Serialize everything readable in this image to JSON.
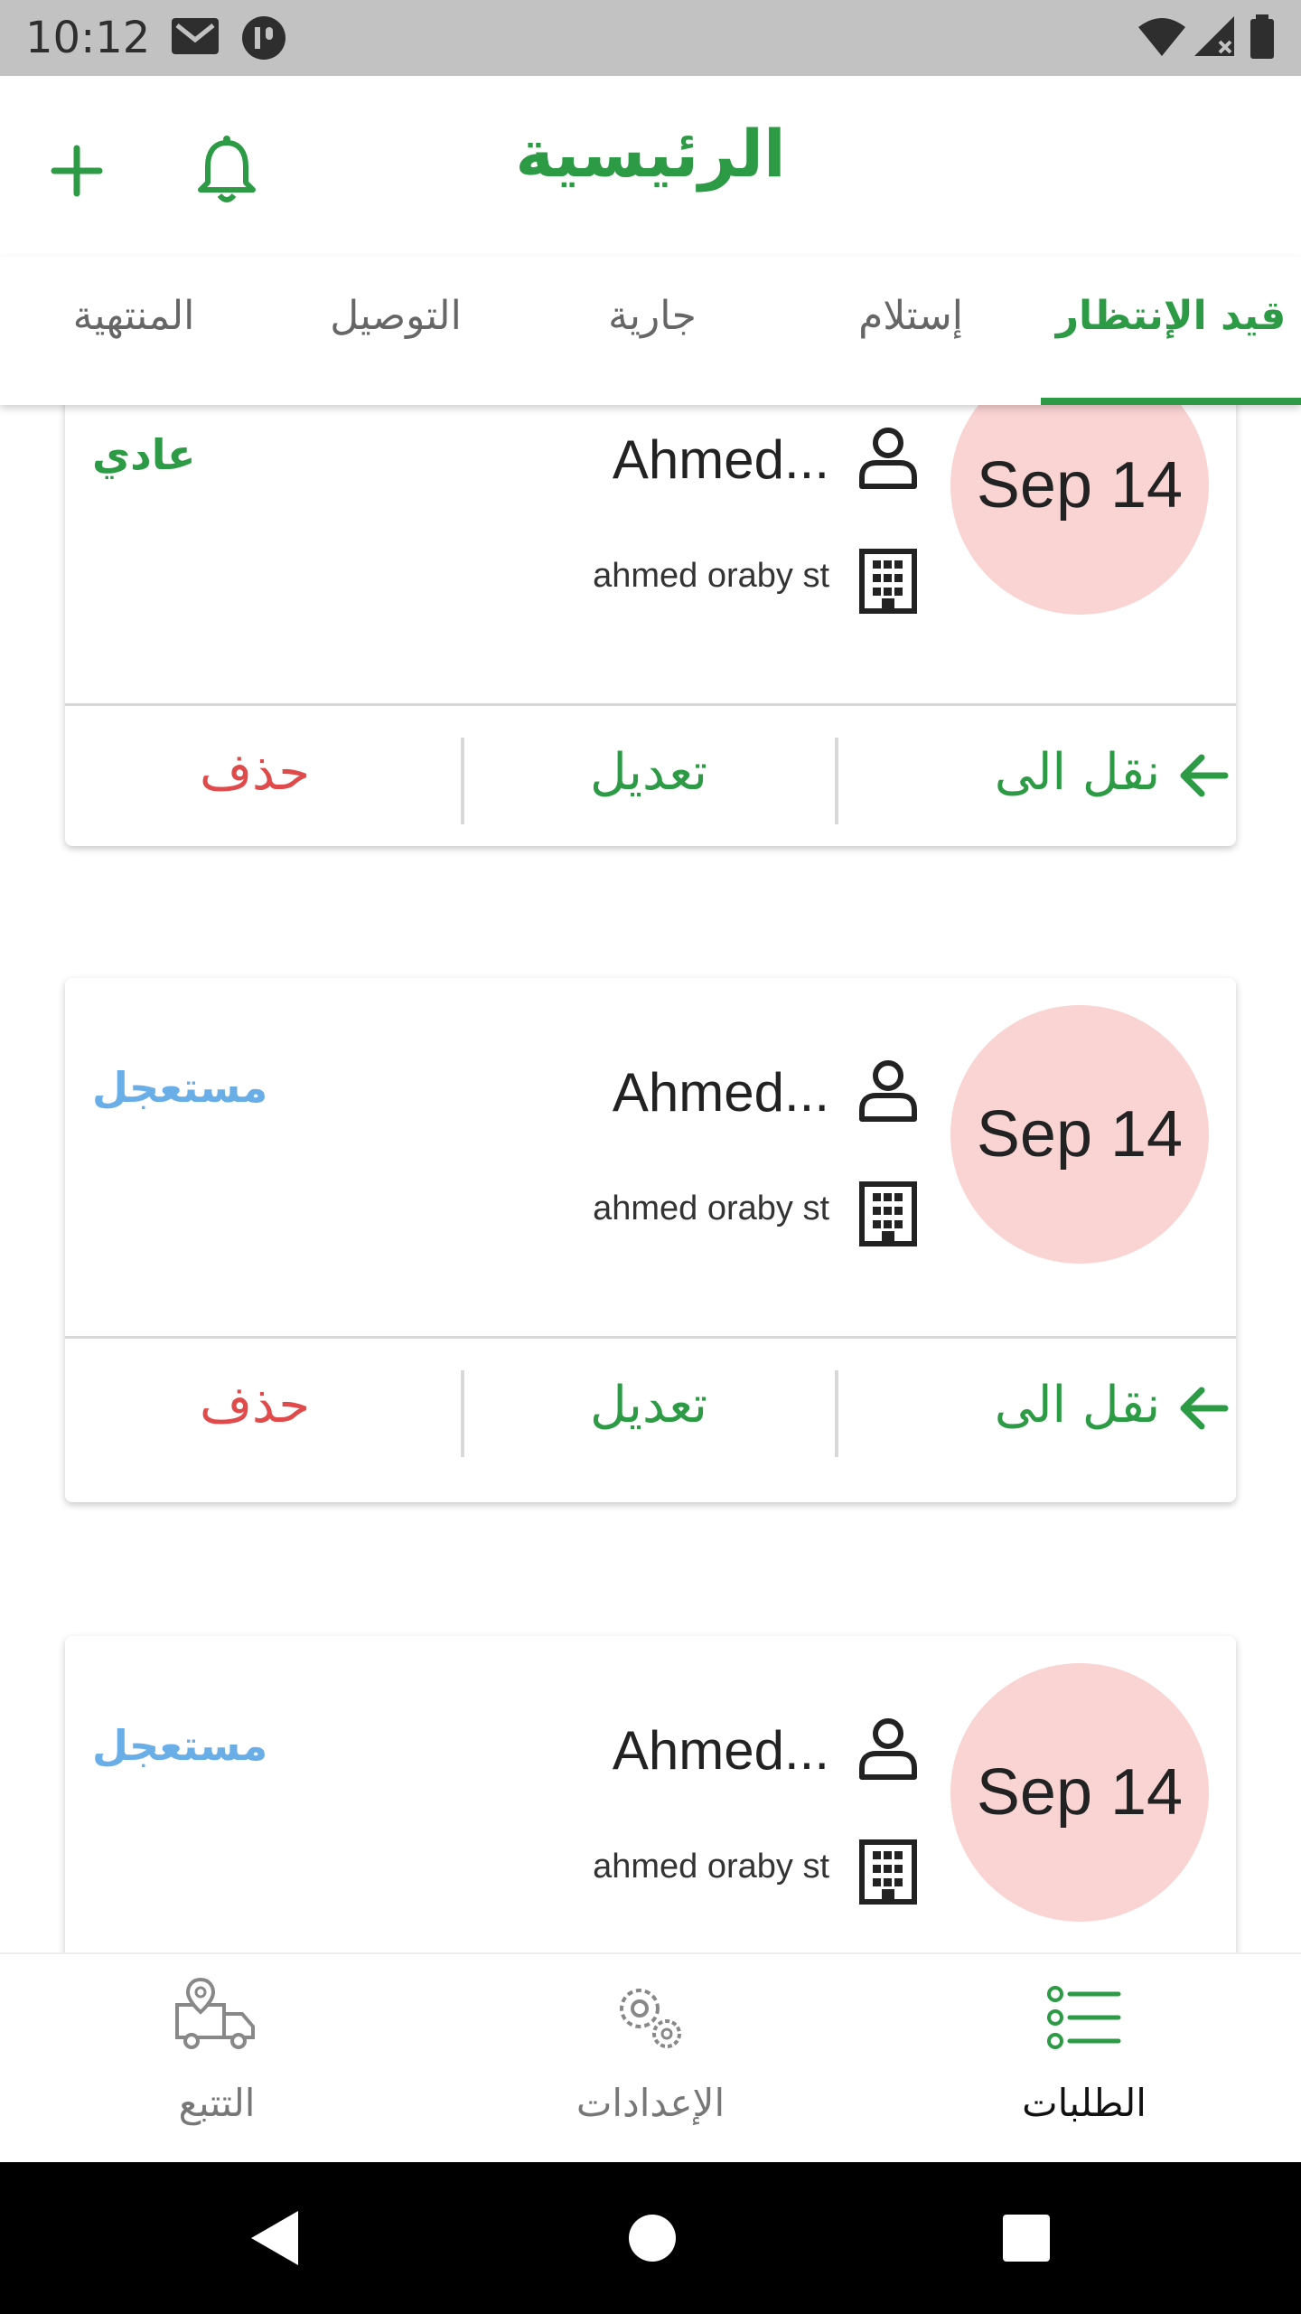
{
  "status_bar": {
    "time": "10:12"
  },
  "header": {
    "title": "الرئيسية",
    "add_icon": "plus-icon",
    "bell_icon": "bell-icon"
  },
  "tabs": [
    {
      "label": "قيد الإنتظار",
      "active": true
    },
    {
      "label": "إستلام",
      "active": false
    },
    {
      "label": "جارية",
      "active": false
    },
    {
      "label": "التوصيل",
      "active": false
    },
    {
      "label": "المنتهية",
      "active": false
    }
  ],
  "orders": [
    {
      "date": "Sep 14",
      "name": "Ahmed...",
      "address": "ahmed oraby st",
      "priority": "عادي",
      "move_label": "نقل الى",
      "edit_label": "تعديل",
      "delete_label": "حذف"
    },
    {
      "date": "Sep 14",
      "name": "Ahmed...",
      "address": "ahmed oraby st",
      "priority": "مستعجل",
      "move_label": "نقل الى",
      "edit_label": "تعديل",
      "delete_label": "حذف"
    },
    {
      "date": "Sep 14",
      "name": "Ahmed...",
      "address": "ahmed oraby st",
      "priority": "مستعجل"
    }
  ],
  "bottom_nav": [
    {
      "label": "الطلبات",
      "icon": "list-icon",
      "active": true
    },
    {
      "label": "الإعدادات",
      "icon": "gear-icon",
      "active": false
    },
    {
      "label": "التتبع",
      "icon": "delivery-truck-icon",
      "active": false
    }
  ],
  "colors": {
    "primary": "#2d9b45",
    "delete": "#e04a4a",
    "urgent": "#6aaee8",
    "date_bg": "#fad3d3"
  }
}
